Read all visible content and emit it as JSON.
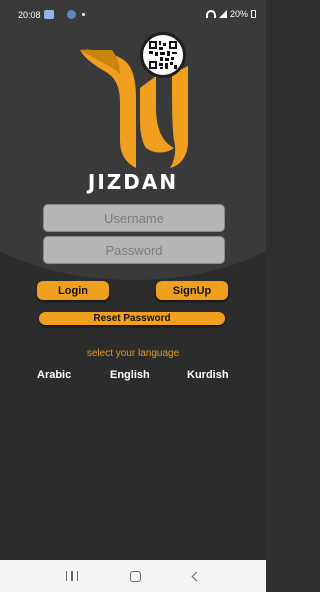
{
  "status": {
    "time": "20:08",
    "battery": "20%"
  },
  "brand": {
    "name": "JIZDAN",
    "accent": "#f0a01e"
  },
  "form": {
    "username_placeholder": "Username",
    "password_placeholder": "Password"
  },
  "buttons": {
    "login": "Login",
    "signup": "SignUp",
    "reset": "Reset Password"
  },
  "language": {
    "label": "select your language",
    "options": [
      "Arabic",
      "English",
      "Kurdish"
    ]
  },
  "icons": {
    "logo": "jizdan-logo-icon",
    "qr": "qr-code-icon",
    "nav": [
      "recent-apps-icon",
      "home-icon",
      "back-icon"
    ]
  }
}
